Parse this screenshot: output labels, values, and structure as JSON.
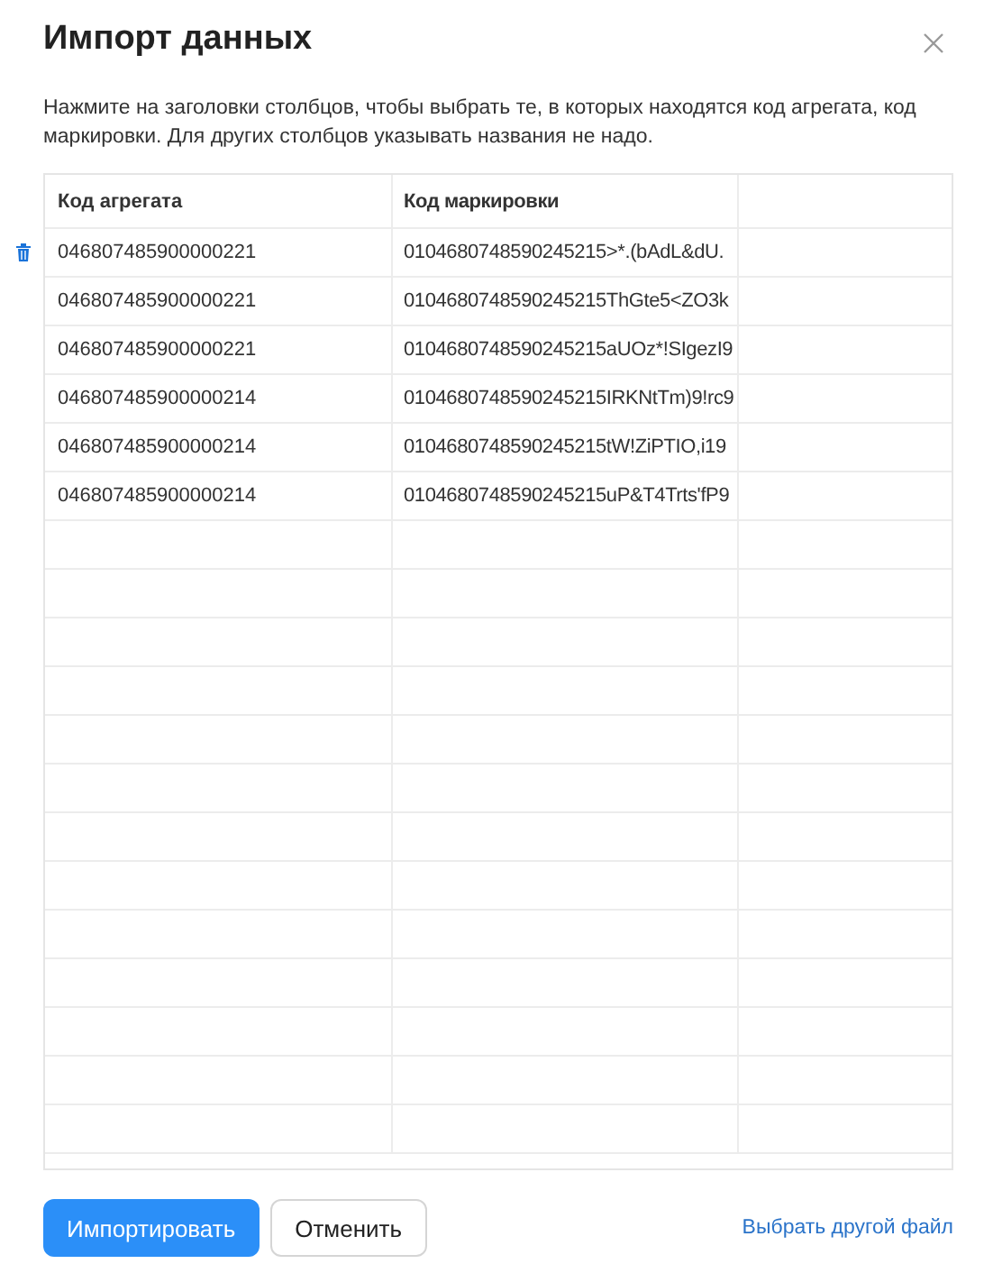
{
  "dialog": {
    "title": "Импорт данных",
    "description": "Нажмите на заголовки столбцов, чтобы выбрать те, в которых находятся код агрегата, код маркировки. Для других столбцов указывать названия не надо."
  },
  "table": {
    "columns": [
      "Код агрегата",
      "Код маркировки"
    ],
    "rows": [
      {
        "cells": [
          "046807485900000221",
          "0104680748590245215>*.(bAdL&dU."
        ],
        "deletable": true
      },
      {
        "cells": [
          "046807485900000221",
          "0104680748590245215ThGte5<ZO3k"
        ],
        "deletable": false
      },
      {
        "cells": [
          "046807485900000221",
          "0104680748590245215aUOz*!SIgezI9"
        ],
        "deletable": false
      },
      {
        "cells": [
          "046807485900000214",
          "0104680748590245215IRKNtTm)9!rc9"
        ],
        "deletable": false
      },
      {
        "cells": [
          "046807485900000214",
          "0104680748590245215tW!ZiPTIO,i19"
        ],
        "deletable": false
      },
      {
        "cells": [
          "046807485900000214",
          "0104680748590245215uP&T4Trts'fP9"
        ],
        "deletable": false
      }
    ]
  },
  "buttons": [
    {
      "label": "Импортировать",
      "kind": "primary"
    },
    {
      "label": "Отменить",
      "kind": "secondary"
    }
  ],
  "link": "Выбрать другой файл"
}
